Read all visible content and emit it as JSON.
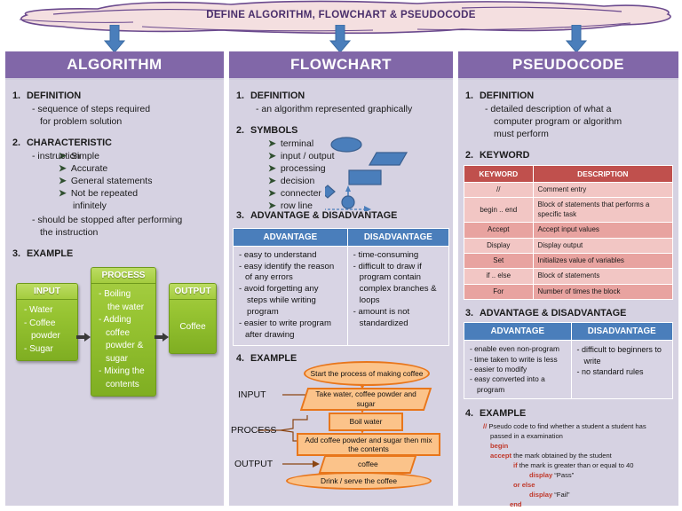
{
  "banner": {
    "title": "DEFINE ALGORITHM, FLOWCHART & PSEUDOCODE"
  },
  "colors": {
    "header_purple": "#8167a8",
    "column_bg": "#d6d2e2",
    "banner_fill": "#f4dfe0",
    "banner_stroke": "#6b4a8e",
    "arrow_blue": "#4a7ebb",
    "table_blue": "#4a7ebb",
    "table_red": "#c0504d",
    "green_box": "#97c432",
    "flow_orange": "#e8761b",
    "flow_fill": "#fbc38a",
    "code_keyword": "#c0392b"
  },
  "columns": [
    {
      "key": "algorithm",
      "header": "ALGORITHM",
      "sections": [
        {
          "num": "1.",
          "title": "DEFINITION",
          "lines": [
            "-  sequence of steps required",
            "for problem solution"
          ]
        },
        {
          "num": "2.",
          "title": "CHARACTERISTIC",
          "lead": "-  instruction",
          "bullets": [
            "Simple",
            "Accurate",
            "General statements",
            "Not be repeated",
            "infinitely"
          ],
          "tail": [
            "-  should be stopped after performing",
            "the instruction"
          ]
        },
        {
          "num": "3.",
          "title": "EXAMPLE"
        }
      ],
      "example": {
        "input": {
          "caption": "INPUT",
          "items": [
            "-  Water",
            "-  Coffee",
            "powder",
            "-  Sugar"
          ]
        },
        "process": {
          "caption": "PROCESS",
          "items": [
            "-  Boiling",
            "the water",
            "-  Adding",
            "coffee",
            "powder &",
            "sugar",
            "-  Mixing the",
            "contents"
          ]
        },
        "output": {
          "caption": "OUTPUT",
          "items": [
            "Coffee"
          ]
        }
      }
    },
    {
      "key": "flowchart",
      "header": "FLOWCHART",
      "sections": [
        {
          "num": "1.",
          "title": "DEFINITION",
          "lines": [
            "-   an algorithm represented graphically"
          ]
        },
        {
          "num": "2.",
          "title": "SYMBOLS",
          "bullets": [
            "terminal",
            "input / output",
            "processing",
            "decision",
            "connecter",
            "row line"
          ]
        },
        {
          "num": "3.",
          "title": "ADVANTAGE & DISADVANTAGE"
        },
        {
          "num": "4.",
          "title": "EXAMPLE"
        }
      ],
      "table": {
        "headers": [
          "ADVANTAGE",
          "DISADVANTAGE"
        ],
        "advantage": [
          "- easy to understand",
          "- easy identify the reason",
          "of any errors",
          "- avoid forgetting any",
          "steps while writing",
          "program",
          "- easier to write program",
          "after drawing"
        ],
        "disadvantage": [
          "- time-consuming",
          "- difficult to draw if",
          "program contain",
          "complex branches &",
          "loops",
          "- amount is not",
          "standardized"
        ]
      },
      "example": {
        "labels": [
          "INPUT",
          "PROCESS",
          "OUTPUT"
        ],
        "nodes": [
          {
            "type": "terminal",
            "text": "Start the process of making coffee"
          },
          {
            "type": "parallelogram",
            "text": "Take water, coffee powder and sugar"
          },
          {
            "type": "rect",
            "text": "Boil water"
          },
          {
            "type": "rect",
            "text": "Add coffee powder and sugar then mix the contents"
          },
          {
            "type": "parallelogram",
            "text": "coffee"
          },
          {
            "type": "terminal",
            "text": "Drink / serve the coffee"
          }
        ]
      }
    },
    {
      "key": "pseudocode",
      "header": "PSEUDOCODE",
      "sections": [
        {
          "num": "1.",
          "title": "DEFINITION",
          "lines": [
            "-   detailed description of what a",
            "computer program or algorithm",
            "must  perform"
          ]
        },
        {
          "num": "2.",
          "title": "KEYWORD"
        },
        {
          "num": "3.",
          "title": "ADVANTAGE & DISADVANTAGE"
        },
        {
          "num": "4.",
          "title": "EXAMPLE"
        }
      ],
      "keyword_table": {
        "headers": [
          "KEYWORD",
          "DESCRIPTION"
        ],
        "rows": [
          {
            "keyword": "//",
            "description": "Comment entry"
          },
          {
            "keyword": "begin .. end",
            "description": "Block of statements  that performs a specific task"
          },
          {
            "keyword": "Accept",
            "description": "Accept input values"
          },
          {
            "keyword": "Display",
            "description": "Display output"
          },
          {
            "keyword": "Set",
            "description": "Initializes value of variables"
          },
          {
            "keyword": "if .. else",
            "description": "Block of statements"
          },
          {
            "keyword": "For",
            "description": "Number of times the block"
          }
        ]
      },
      "table": {
        "headers": [
          "ADVANTAGE",
          "DISADVANTAGE"
        ],
        "advantage": [
          "- enable even non-program",
          "- time taken to  write  is less",
          "- easier to modify",
          "- easy converted into  a",
          "program"
        ],
        "disadvantage": [
          "-  difficult to beginners to",
          "write",
          "-  no standard rules"
        ]
      },
      "code": [
        {
          "indent": "ind1",
          "kw": "//",
          "rest": " Pseudo code to find whether a student a student has"
        },
        {
          "indent": "ind2",
          "kw": "",
          "rest": "passed in a examination"
        },
        {
          "indent": "ind2",
          "kw": "begin",
          "rest": ""
        },
        {
          "indent": "ind2",
          "kw": "accept",
          "rest": " the mark obtained by the student"
        },
        {
          "indent": "ind3",
          "kw": "if",
          "rest": " the mark is greater than or equal to 40"
        },
        {
          "indent": "ind4",
          "kw": "display",
          "rest": " “Pass”"
        },
        {
          "indent": "ind3",
          "kw": "or else",
          "rest": ""
        },
        {
          "indent": "ind4",
          "kw": "display",
          "rest": " “Fail”"
        },
        {
          "indent": "ind5",
          "kw": "end",
          "rest": ""
        }
      ]
    }
  ]
}
